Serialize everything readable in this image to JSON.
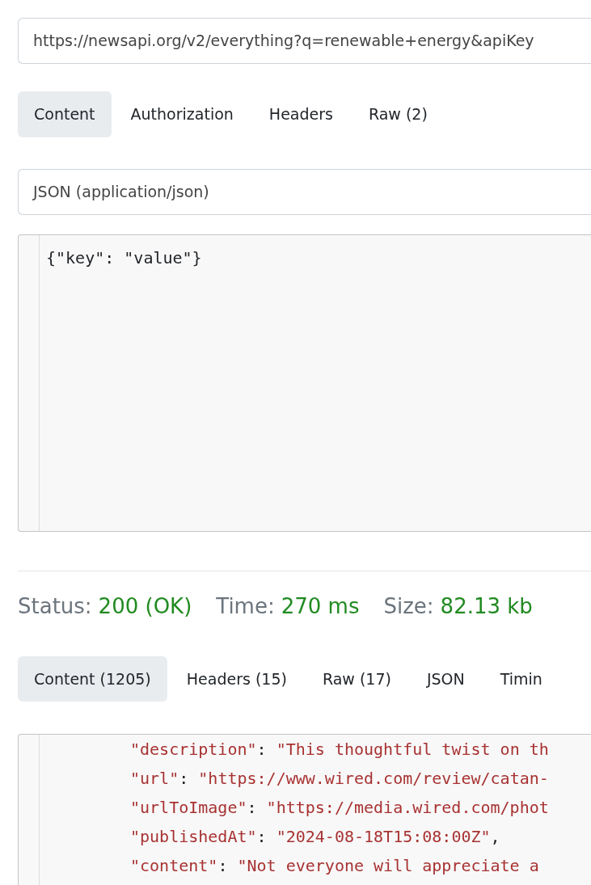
{
  "url": {
    "value": "https://newsapi.org/v2/everything?q=renewable+energy&apiKey"
  },
  "request_tabs": [
    {
      "label": "Content",
      "selected": true
    },
    {
      "label": "Authorization",
      "selected": false
    },
    {
      "label": "Headers",
      "selected": false
    },
    {
      "label": "Raw (2)",
      "selected": false
    }
  ],
  "content_type": {
    "value": "JSON (application/json)"
  },
  "request_body": {
    "lines": [
      "{\"key\": \"value\"}"
    ]
  },
  "response_stats": [
    {
      "label": "Status:",
      "value": "200 (OK)"
    },
    {
      "label": "Time:",
      "value": "270 ms"
    },
    {
      "label": "Size:",
      "value": "82.13 kb"
    }
  ],
  "response_tabs": [
    {
      "label": "Content (1205)",
      "selected": true
    },
    {
      "label": "Headers (15)",
      "selected": false
    },
    {
      "label": "Raw (17)",
      "selected": false
    },
    {
      "label": "JSON",
      "selected": false
    },
    {
      "label": "Timin",
      "selected": false
    }
  ],
  "response_body": {
    "lines": [
      [
        {
          "kind": "string",
          "text": "\"description\""
        },
        {
          "kind": "punct",
          "text": ": "
        },
        {
          "kind": "string",
          "text": "\"This thoughtful twist on th"
        }
      ],
      [
        {
          "kind": "string",
          "text": "\"url\""
        },
        {
          "kind": "punct",
          "text": ": "
        },
        {
          "kind": "string",
          "text": "\"https://www.wired.com/review/catan-"
        }
      ],
      [
        {
          "kind": "string",
          "text": "\"urlToImage\""
        },
        {
          "kind": "punct",
          "text": ": "
        },
        {
          "kind": "string",
          "text": "\"https://media.wired.com/phot"
        }
      ],
      [
        {
          "kind": "string",
          "text": "\"publishedAt\""
        },
        {
          "kind": "punct",
          "text": ": "
        },
        {
          "kind": "string",
          "text": "\"2024-08-18T15:08:00Z\""
        },
        {
          "kind": "punct",
          "text": ","
        }
      ],
      [
        {
          "kind": "string",
          "text": "\"content\""
        },
        {
          "kind": "punct",
          "text": ": "
        },
        {
          "kind": "string",
          "text": "\"Not everyone will appreciate a"
        }
      ]
    ]
  }
}
